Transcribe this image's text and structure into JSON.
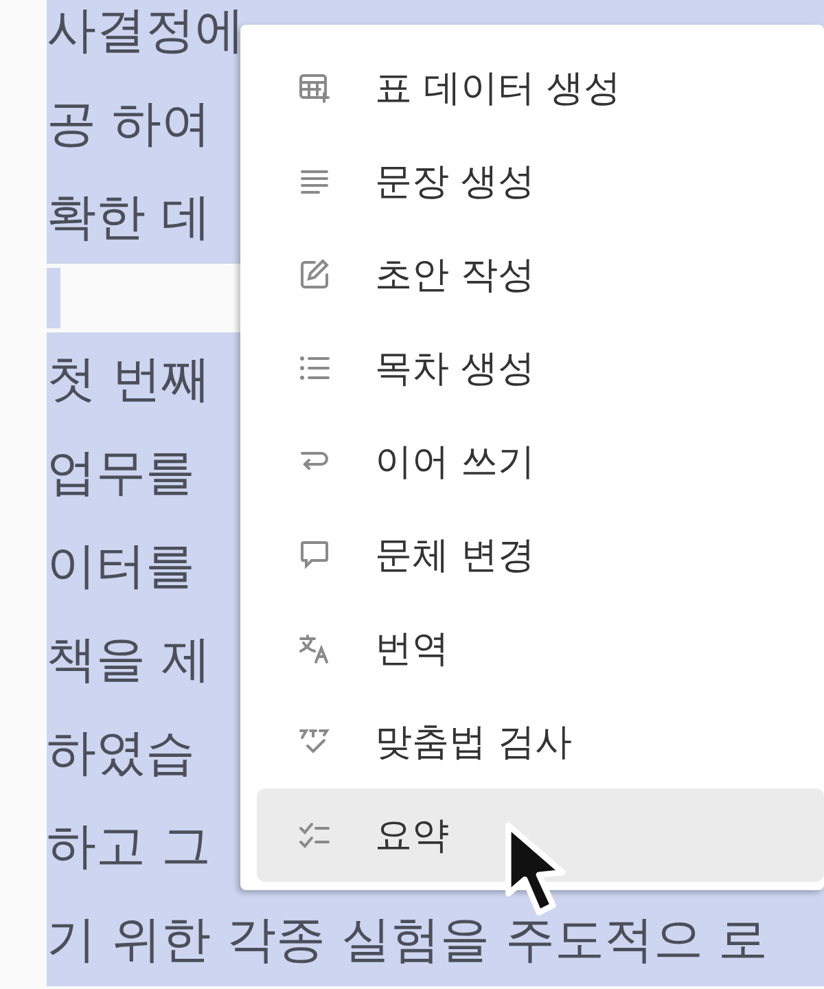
{
  "document": {
    "lines": [
      {
        "kind": "text",
        "text": "사결정에"
      },
      {
        "kind": "text",
        "text": "공 하여"
      },
      {
        "kind": "text",
        "text": "확한 데"
      },
      {
        "kind": "blank"
      },
      {
        "kind": "text",
        "text": "첫 번째"
      },
      {
        "kind": "text",
        "text": "업무를"
      },
      {
        "kind": "text",
        "text": "이터를"
      },
      {
        "kind": "text",
        "text": "책을 제"
      },
      {
        "kind": "text",
        "text": "하였습"
      },
      {
        "kind": "text",
        "text": "하고 그"
      },
      {
        "kind": "text",
        "text": "기 위한 각종 실험을 주도적으 로"
      }
    ]
  },
  "menu": {
    "items": [
      {
        "label": "표 데이터 생성",
        "selected": false
      },
      {
        "label": "문장 생성",
        "selected": false
      },
      {
        "label": "초안 작성",
        "selected": false
      },
      {
        "label": "목차 생성",
        "selected": false
      },
      {
        "label": "이어 쓰기",
        "selected": false
      },
      {
        "label": "문체 변경",
        "selected": false
      },
      {
        "label": "번역",
        "selected": false
      },
      {
        "label": "맞춤법 검사",
        "selected": false
      },
      {
        "label": "요약",
        "selected": true
      }
    ]
  }
}
